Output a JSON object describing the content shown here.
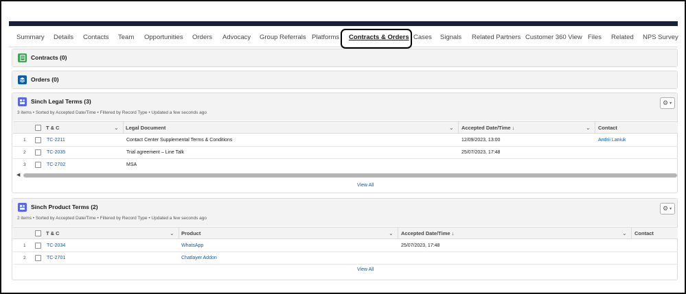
{
  "tabs": [
    {
      "label": "Summary"
    },
    {
      "label": "Details"
    },
    {
      "label": "Contacts"
    },
    {
      "label": "Team"
    },
    {
      "label": "Opportunities"
    },
    {
      "label": "Orders"
    },
    {
      "label": "Advocacy"
    },
    {
      "label": "Group Referrals"
    },
    {
      "label": "Platforms"
    },
    {
      "label": "Contracts & Orders",
      "active": true
    },
    {
      "label": "Cases"
    },
    {
      "label": "Signals"
    },
    {
      "label": "Related Partners"
    },
    {
      "label": "Customer 360 View"
    },
    {
      "label": "Files"
    },
    {
      "label": "Related"
    },
    {
      "label": "NPS Survey"
    }
  ],
  "contracts": {
    "title": "Contracts (0)",
    "icon": "contract-icon",
    "icon_color": "#3ba755"
  },
  "orders": {
    "title": "Orders (0)",
    "icon": "orders-icon",
    "icon_color": "#0b5cab"
  },
  "legal_terms": {
    "title": "Sinch Legal Terms (3)",
    "meta": "3 items • Sorted by Accepted Date/Time • Filtered by Record Type • Updated a few seconds ago",
    "icon_color": "#5867e8",
    "columns": {
      "tc": "T & C",
      "doc": "Legal Document",
      "date": "Accepted Date/Time ↓",
      "contact": "Contact"
    },
    "rows": [
      {
        "num": "1",
        "tc": "TC-2211",
        "doc": "Contact Center Supplemental Terms & Conditions",
        "date": "12/09/2023, 13:00",
        "contact": "Andrii Laniuk"
      },
      {
        "num": "2",
        "tc": "TC-2035",
        "doc": "Trial agreement – Line Talk",
        "date": "25/07/2023, 17:48",
        "contact": ""
      },
      {
        "num": "3",
        "tc": "TC-2702",
        "doc": "MSA",
        "date": "",
        "contact": ""
      }
    ],
    "view_all": "View All"
  },
  "product_terms": {
    "title": "Sinch Product Terms (2)",
    "meta": "2 items • Sorted by Accepted Date/Time • Filtered by Record Type • Updated a few seconds ago",
    "icon_color": "#5867e8",
    "columns": {
      "tc": "T & C",
      "product": "Product",
      "date": "Accepted Date/Time ↓",
      "contact": "Contact"
    },
    "rows": [
      {
        "num": "1",
        "tc": "TC-2034",
        "product": "WhatsApp",
        "date": "25/07/2023, 17:48"
      },
      {
        "num": "2",
        "tc": "TC-2701",
        "product": "Chatlayer Addon",
        "date": ""
      }
    ],
    "view_all": "View All"
  },
  "colors": {
    "link": "#0b5cab",
    "header_bar": "#16213e"
  }
}
